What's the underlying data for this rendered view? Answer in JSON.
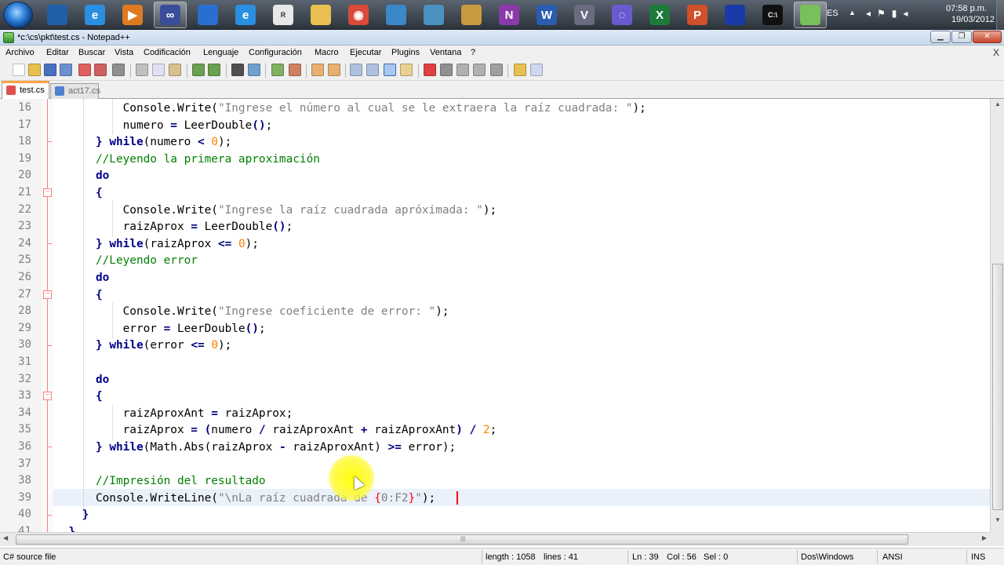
{
  "taskbar": {
    "apps": [
      {
        "name": "media-center",
        "color": "#1f5fa8",
        "glyph": ""
      },
      {
        "name": "internet-explorer",
        "color": "#2a8fe0",
        "glyph": "e"
      },
      {
        "name": "media-player",
        "color": "#e07a1f",
        "glyph": "▶"
      },
      {
        "name": "infinity",
        "color": "#3a4d9a",
        "glyph": "∞"
      },
      {
        "name": "window",
        "color": "#2a6fd0",
        "glyph": ""
      },
      {
        "name": "internet-explorer-2",
        "color": "#2a8fe0",
        "glyph": "e"
      },
      {
        "name": "rom",
        "color": "#e8e8e8",
        "glyph": "R"
      },
      {
        "name": "folder",
        "color": "#e8c050",
        "glyph": ""
      },
      {
        "name": "chrome",
        "color": "#d94a3a",
        "glyph": "◉"
      },
      {
        "name": "users",
        "color": "#3a88c8",
        "glyph": ""
      },
      {
        "name": "remote",
        "color": "#4a90c0",
        "glyph": ""
      },
      {
        "name": "paint",
        "color": "#c89a40",
        "glyph": ""
      },
      {
        "name": "onenote",
        "color": "#8a3aa8",
        "glyph": "N"
      },
      {
        "name": "word",
        "color": "#2a5cb0",
        "glyph": "W"
      },
      {
        "name": "visual-studio",
        "color": "#6a6a80",
        "glyph": "V"
      },
      {
        "name": "geogebra",
        "color": "#6a5ad0",
        "glyph": "◌"
      },
      {
        "name": "excel",
        "color": "#1e7a3a",
        "glyph": "X"
      },
      {
        "name": "powerpoint",
        "color": "#d0502a",
        "glyph": "P"
      },
      {
        "name": "app-blue",
        "color": "#1a3aa8",
        "glyph": ""
      },
      {
        "name": "terminal",
        "color": "#111111",
        "glyph": "C:\\"
      },
      {
        "name": "notepad-plus-plus",
        "color": "#7ac05a",
        "glyph": ""
      }
    ],
    "lang": "ES",
    "time": "07:58 p.m.",
    "date": "19/03/2012"
  },
  "window": {
    "title": "*c:\\cs\\pkt\\test.cs - Notepad++"
  },
  "menu": [
    "Archivo",
    "Editar",
    "Buscar",
    "Vista",
    "Codificación",
    "Lenguaje",
    "Configuración",
    "Macro",
    "Ejecutar",
    "Plugins",
    "Ventana",
    "?"
  ],
  "menu_close": "X",
  "tabs": [
    {
      "label": "test.cs",
      "active": true,
      "color": "#e05050"
    },
    {
      "label": "act17.cs",
      "active": false,
      "color": "#5080d0"
    }
  ],
  "editor": {
    "line_numbers": [
      "16",
      "17",
      "18",
      "19",
      "20",
      "21",
      "22",
      "23",
      "24",
      "25",
      "26",
      "27",
      "28",
      "29",
      "30",
      "31",
      "32",
      "33",
      "34",
      "35",
      "36",
      "37",
      "38",
      "39",
      "40",
      "41"
    ],
    "current_line": "39"
  },
  "status": {
    "file_type": "C# source file",
    "length": "length : 1058",
    "lines": "lines : 41",
    "ln": "Ln : 39",
    "col": "Col : 56",
    "sel": "Sel : 0",
    "eol": "Dos\\Windows",
    "encoding": "ANSI",
    "mode": "INS"
  }
}
